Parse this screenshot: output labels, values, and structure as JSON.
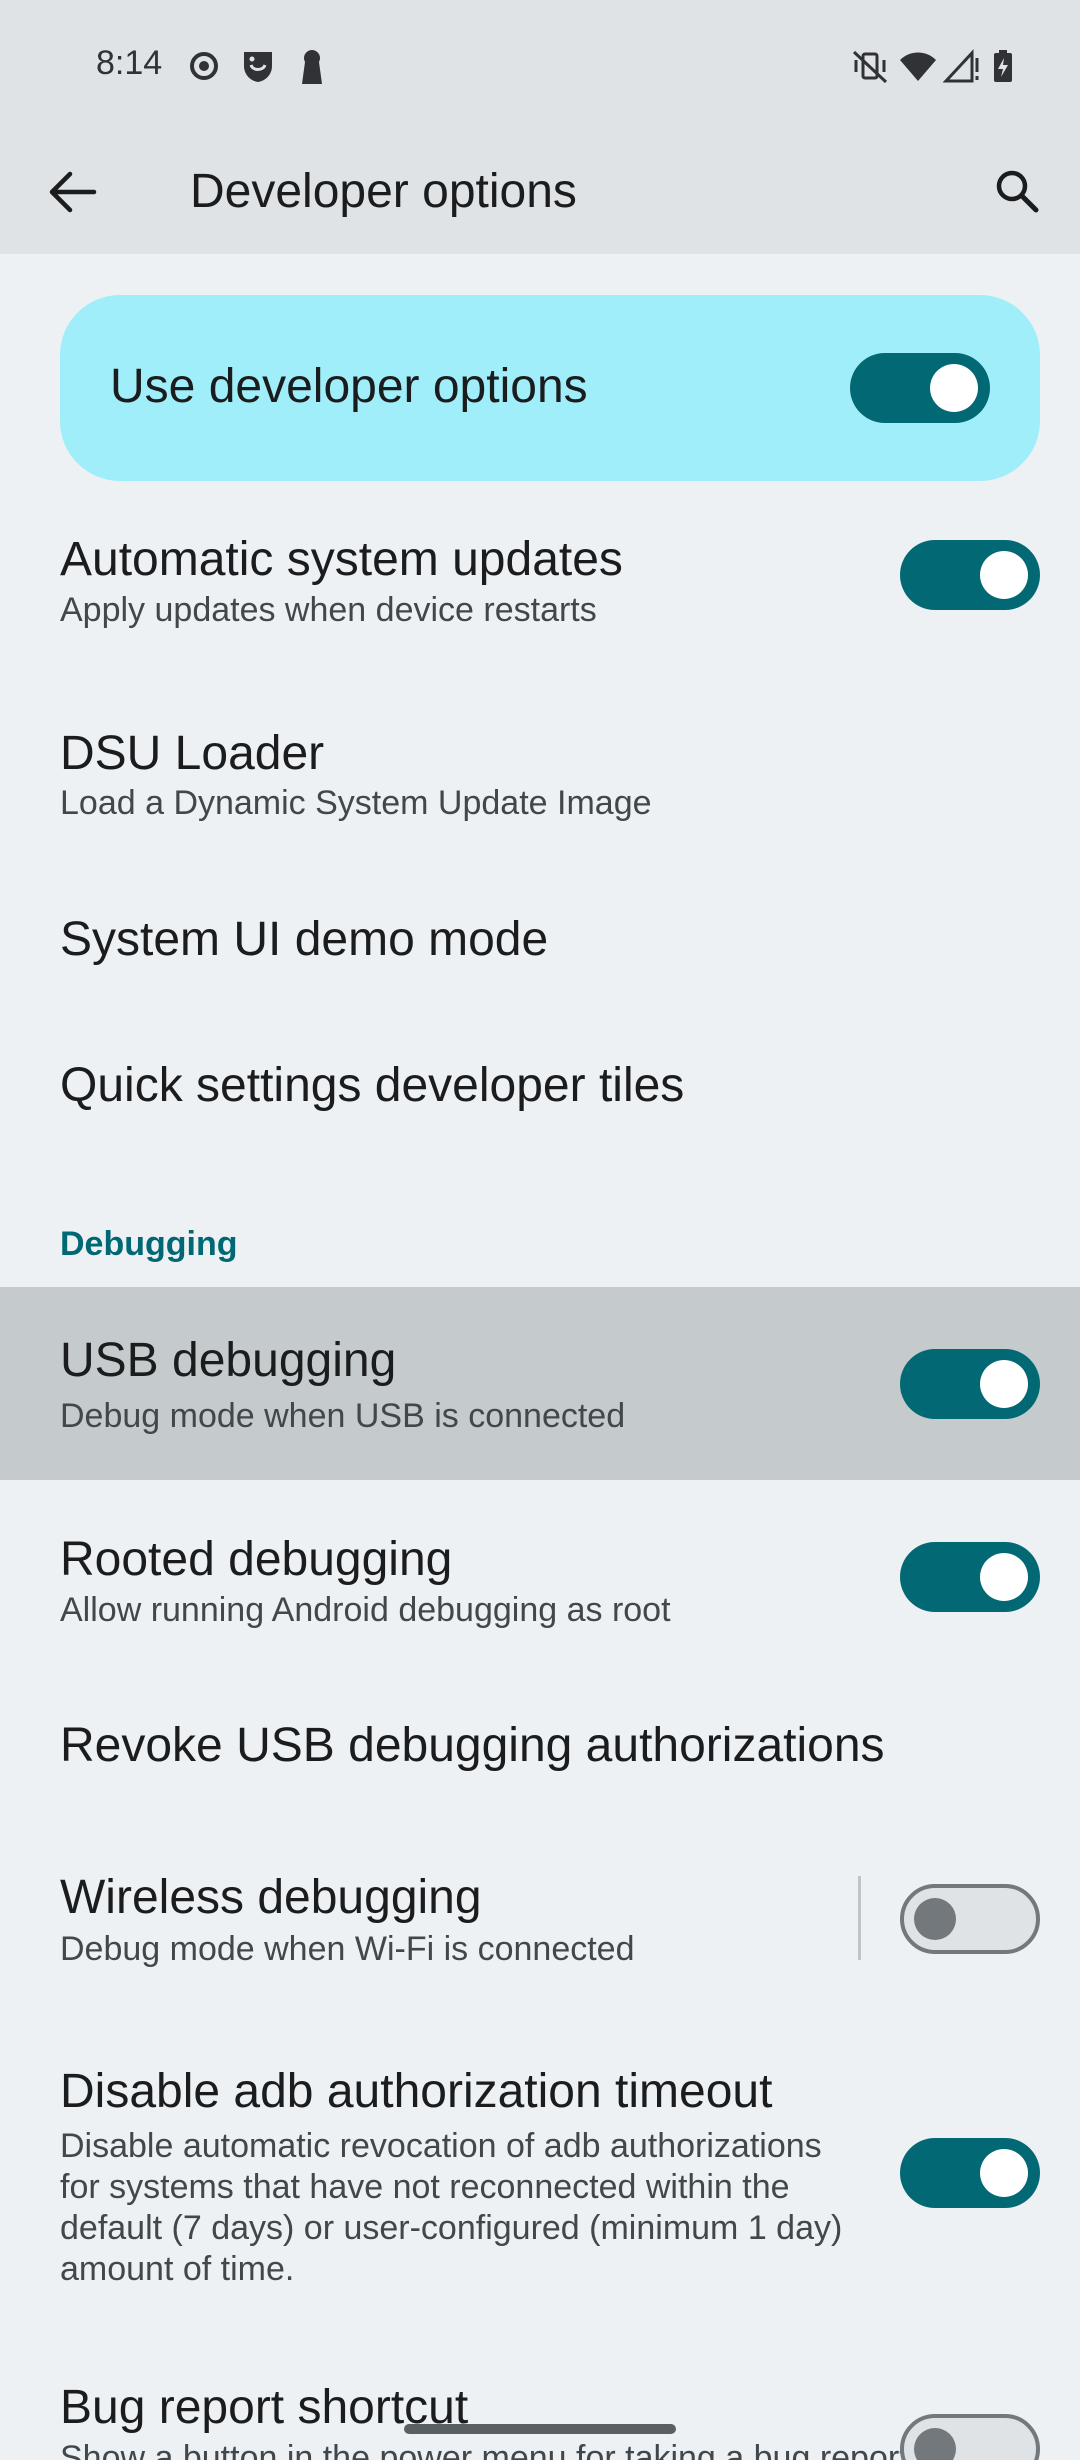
{
  "status_bar": {
    "time": "8:14",
    "left_icons": [
      "radio-button-icon",
      "shield-face-icon",
      "keyhole-icon"
    ],
    "right_icons": [
      "vibrate-off-icon",
      "wifi-icon",
      "signal-icon",
      "battery-icon"
    ]
  },
  "header": {
    "title": "Developer options",
    "back_icon": "arrow-back-icon",
    "search_icon": "search-icon"
  },
  "main_toggle": {
    "label": "Use developer options",
    "on": true
  },
  "items": [
    {
      "title": "Automatic system updates",
      "subtitle": "Apply updates when device restarts",
      "toggle": "on"
    },
    {
      "title": "DSU Loader",
      "subtitle": "Load a Dynamic System Update Image"
    },
    {
      "title": "System UI demo mode"
    },
    {
      "title": "Quick settings developer tiles"
    }
  ],
  "debugging": {
    "header": "Debugging",
    "items": [
      {
        "title": "USB debugging",
        "subtitle": "Debug mode when USB is connected",
        "toggle": "on",
        "highlighted": true
      },
      {
        "title": "Rooted debugging",
        "subtitle": "Allow running Android debugging as root",
        "toggle": "on"
      },
      {
        "title": "Revoke USB debugging authorizations"
      },
      {
        "title": "Wireless debugging",
        "subtitle": "Debug mode when Wi-Fi is connected",
        "toggle": "off"
      },
      {
        "title": "Disable adb authorization timeout",
        "subtitle": "Disable automatic revocation of adb authorizations for systems that have not reconnected within the default (7 days) or user-configured (minimum 1 day) amount of time.",
        "toggle": "on"
      },
      {
        "title": "Bug report shortcut",
        "subtitle": "Show a button in the power menu for taking a bug report",
        "toggle": "off"
      }
    ]
  },
  "colors": {
    "accent": "#026874",
    "card": "#a0eefa",
    "background": "#edf1f4",
    "highlight": "#c5cbcd"
  }
}
